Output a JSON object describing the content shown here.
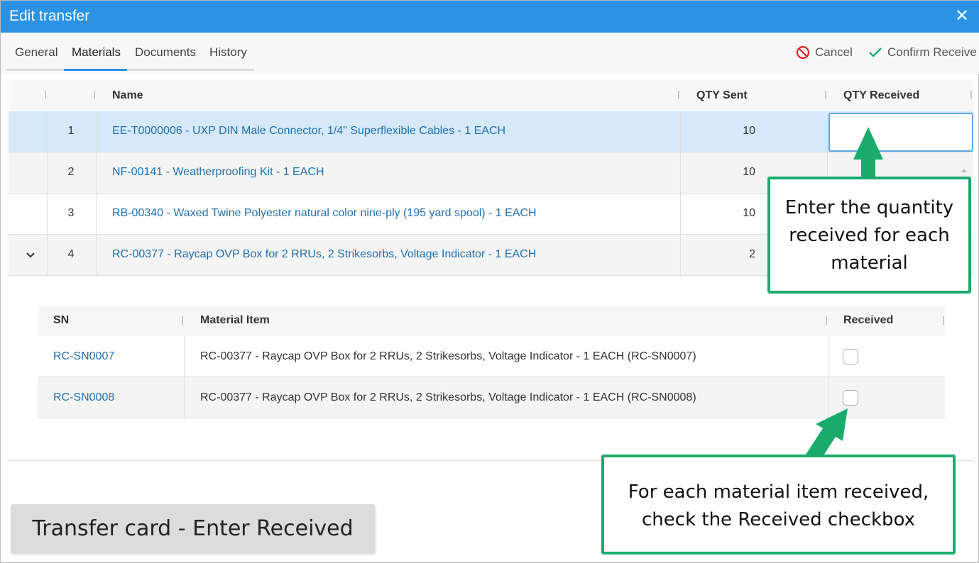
{
  "window": {
    "title": "Edit transfer",
    "close_glyph": "✕"
  },
  "tabs": [
    {
      "label": "General",
      "active": false
    },
    {
      "label": "Materials",
      "active": true
    },
    {
      "label": "Documents",
      "active": false
    },
    {
      "label": "History",
      "active": false
    }
  ],
  "actions": {
    "cancel_label": "Cancel",
    "cancel_icon": "cancel-icon",
    "confirm_label": "Confirm Receive",
    "confirm_icon": "checkmark-icon"
  },
  "materials_table": {
    "columns": [
      "Name",
      "QTY Sent",
      "QTY Received"
    ],
    "rows": [
      {
        "no": "1",
        "name": "EE-T0000006 - UXP DIN Male Connector, 1/4\" Superflexible Cables - 1 EACH",
        "qty_sent": "10",
        "selected": true
      },
      {
        "no": "2",
        "name": "NF-00141 - Weatherproofing Kit - 1 EACH",
        "qty_sent": "10",
        "selected": false
      },
      {
        "no": "3",
        "name": "RB-00340 - Waxed Twine Polyester natural color nine-ply (195 yard spool) - 1 EACH",
        "qty_sent": "10",
        "selected": false
      },
      {
        "no": "4",
        "name": "RC-00377 - Raycap OVP Box for 2 RRUs, 2 Strikesorbs, Voltage Indicator - 1 EACH",
        "qty_sent": "2",
        "selected": false,
        "expanded": true
      }
    ],
    "qty_received_value": ""
  },
  "detail_table": {
    "columns": [
      "SN",
      "Material Item",
      "Received"
    ],
    "rows": [
      {
        "sn": "RC-SN0007",
        "item": "RC-00377 - Raycap OVP Box for 2 RRUs, 2 Strikesorbs, Voltage Indicator - 1 EACH (RC-SN0007)",
        "received": false
      },
      {
        "sn": "RC-SN0008",
        "item": "RC-00377 - Raycap OVP Box for 2 RRUs, 2 Strikesorbs, Voltage Indicator - 1 EACH (RC-SN0008)",
        "received": false
      }
    ]
  },
  "annotations": {
    "qty_callout": [
      "Enter the quantity",
      "received for each",
      "material"
    ],
    "received_callout": [
      "For each material item received,",
      "check the Received checkbox"
    ],
    "caption": "Transfer card - Enter Received"
  },
  "colors": {
    "title_bar": "#2b92e4",
    "link": "#1f6fb0",
    "callout_border": "#1aab6c",
    "cancel_icon": "#e02020",
    "confirm_icon": "#1aab6c"
  }
}
